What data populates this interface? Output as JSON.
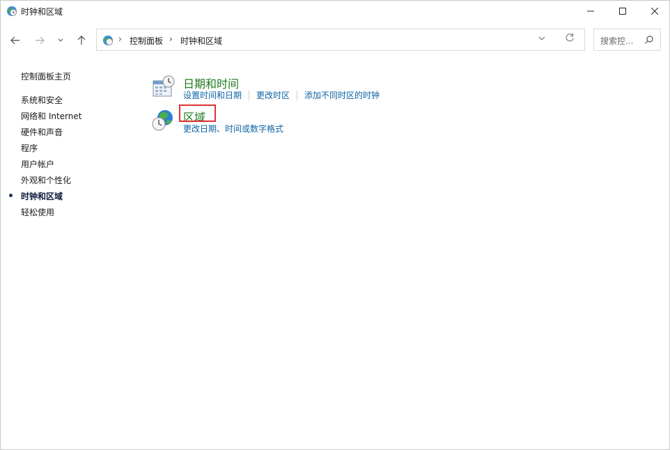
{
  "window": {
    "title": "时钟和区域"
  },
  "window_controls": {
    "minimize": "—",
    "maximize": "☐",
    "close": "✕"
  },
  "nav": {
    "back_icon": "arrow-left",
    "forward_icon": "arrow-right",
    "recent_icon": "chevron-down",
    "up_icon": "arrow-up"
  },
  "address": {
    "breadcrumbs": [
      "控制面板",
      "时钟和区域"
    ],
    "dropdown_icon": "chevron-down",
    "refresh_icon": "refresh"
  },
  "search": {
    "placeholder": "搜索控..."
  },
  "sidebar": {
    "home": "控制面板主页",
    "items": [
      "系统和安全",
      "网络和 Internet",
      "硬件和声音",
      "程序",
      "用户帐户",
      "外观和个性化",
      "时钟和区域",
      "轻松使用"
    ],
    "current_index": 6
  },
  "categories": [
    {
      "title": "日期和时间",
      "links": [
        "设置时间和日期",
        "更改时区",
        "添加不同时区的时钟"
      ]
    },
    {
      "title": "区域",
      "links": [
        "更改日期、时间或数字格式"
      ]
    }
  ],
  "colors": {
    "category_title": "#1e7a1e",
    "link": "#0b63a6",
    "highlight": "#e0312f",
    "current_bullet": "#1b2b5c"
  }
}
